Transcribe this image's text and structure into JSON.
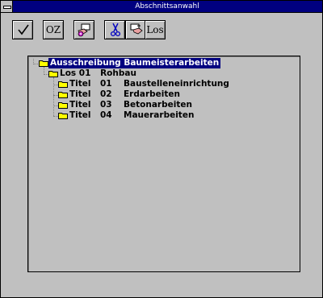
{
  "window": {
    "title": "Abschnittsanwahl"
  },
  "toolbar": {
    "buttons": [
      {
        "name": "ok-check",
        "icon": "checkmark-icon"
      },
      {
        "name": "oz",
        "label": "OZ"
      },
      {
        "name": "insert",
        "icon": "insert-hand-icon"
      },
      {
        "name": "cut",
        "icon": "scissors-icon"
      },
      {
        "name": "paste",
        "icon": "paste-hand-icon"
      },
      {
        "name": "los",
        "label": "Los"
      }
    ]
  },
  "tree": {
    "root": {
      "label": "Ausschreibung Baumeisterarbeiten",
      "selected": true
    },
    "los": {
      "label": "Los 01",
      "name": "Rohbau"
    },
    "titles": [
      {
        "label": "Titel",
        "num": "01",
        "name": "Baustelleneinrichtung"
      },
      {
        "label": "Titel",
        "num": "02",
        "name": "Erdarbeiten"
      },
      {
        "label": "Titel",
        "num": "03",
        "name": "Betonarbeiten"
      },
      {
        "label": "Titel",
        "num": "04",
        "name": "Mauerarbeiten"
      }
    ]
  },
  "colors": {
    "selection": "#000080",
    "face": "#c0c0c0",
    "folder": "#ffff00"
  }
}
